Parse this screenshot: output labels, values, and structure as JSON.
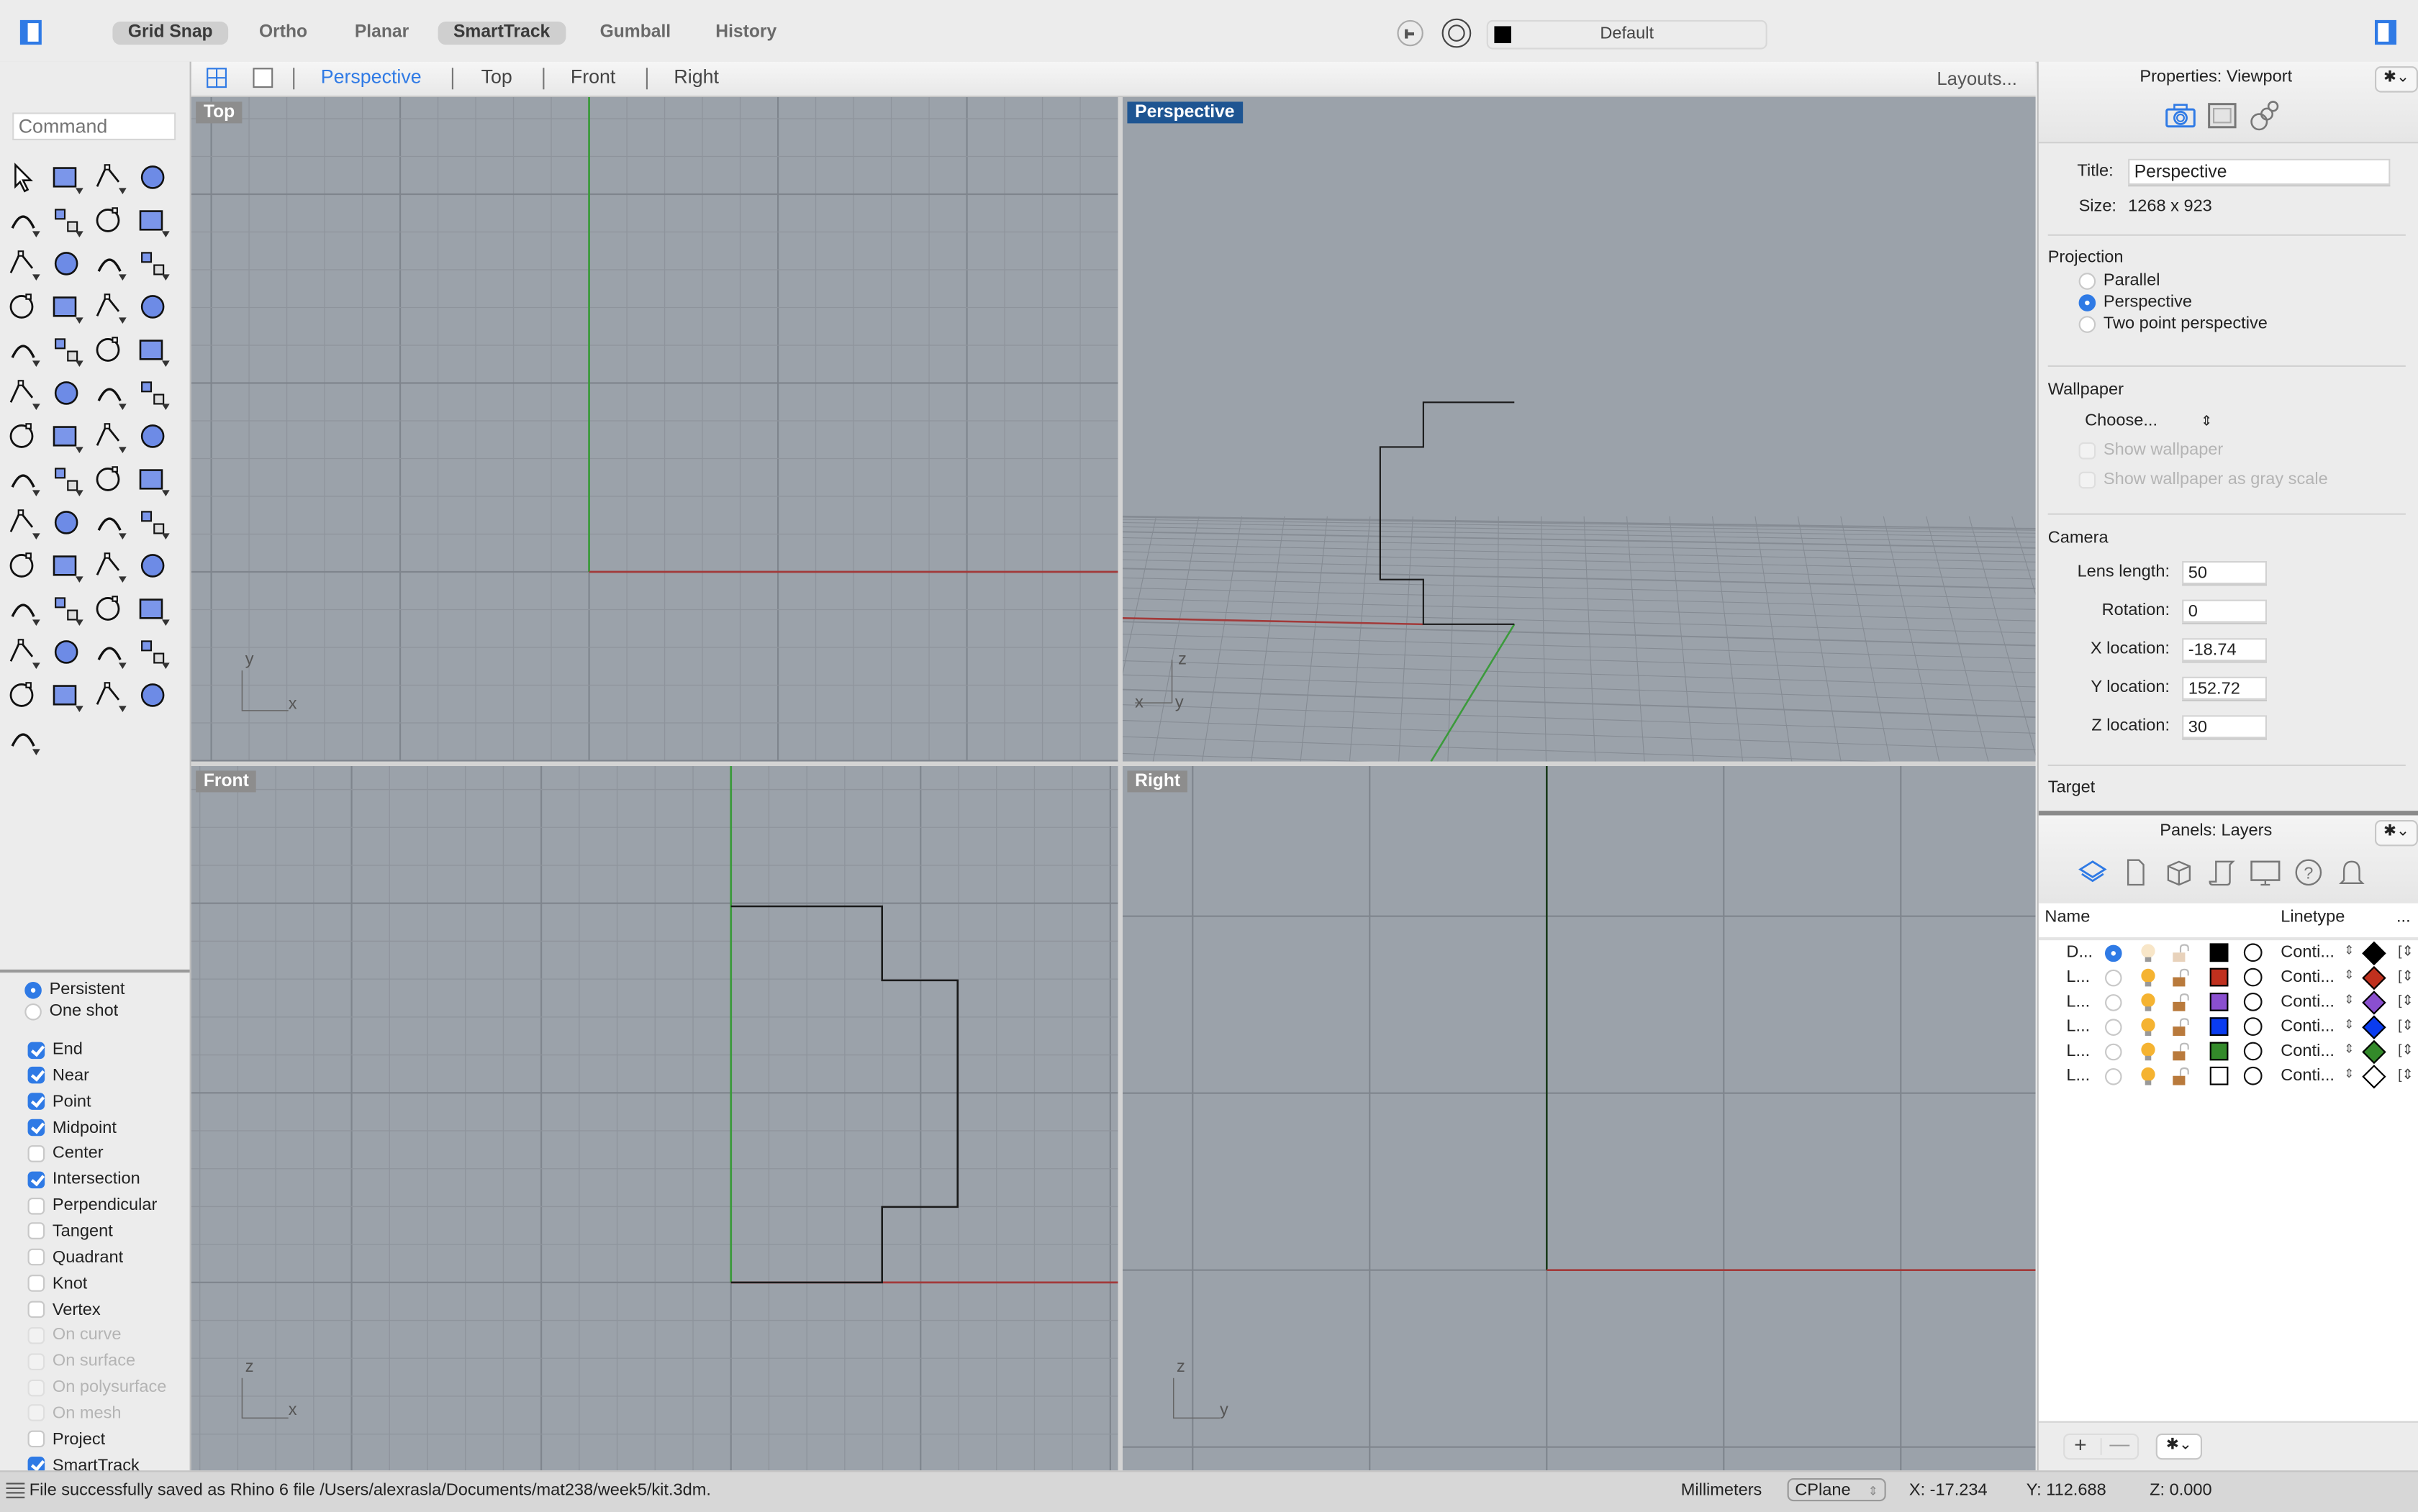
{
  "toolbar": {
    "modes": [
      {
        "label": "Grid Snap",
        "on": true
      },
      {
        "label": "Ortho",
        "on": false
      },
      {
        "label": "Planar",
        "on": false
      },
      {
        "label": "SmartTrack",
        "on": true
      },
      {
        "label": "Gumball",
        "on": false
      },
      {
        "label": "History",
        "on": false
      }
    ],
    "current_layer": "Default",
    "current_layer_color": "#000000"
  },
  "viewport_tabs": {
    "tabs": [
      "Perspective",
      "Top",
      "Front",
      "Right"
    ],
    "active": "Perspective",
    "layouts_label": "Layouts..."
  },
  "command": {
    "placeholder": "Command"
  },
  "osnap": {
    "mode_options": [
      {
        "label": "Persistent",
        "selected": true
      },
      {
        "label": "One shot",
        "selected": false
      }
    ],
    "snaps": [
      {
        "label": "End",
        "checked": true,
        "enabled": true
      },
      {
        "label": "Near",
        "checked": true,
        "enabled": true
      },
      {
        "label": "Point",
        "checked": true,
        "enabled": true
      },
      {
        "label": "Midpoint",
        "checked": true,
        "enabled": true
      },
      {
        "label": "Center",
        "checked": false,
        "enabled": true
      },
      {
        "label": "Intersection",
        "checked": true,
        "enabled": true
      },
      {
        "label": "Perpendicular",
        "checked": false,
        "enabled": true
      },
      {
        "label": "Tangent",
        "checked": false,
        "enabled": true
      },
      {
        "label": "Quadrant",
        "checked": false,
        "enabled": true
      },
      {
        "label": "Knot",
        "checked": false,
        "enabled": true
      },
      {
        "label": "Vertex",
        "checked": false,
        "enabled": true
      },
      {
        "label": "On curve",
        "checked": false,
        "enabled": false
      },
      {
        "label": "On surface",
        "checked": false,
        "enabled": false
      },
      {
        "label": "On polysurface",
        "checked": false,
        "enabled": false
      },
      {
        "label": "On mesh",
        "checked": false,
        "enabled": false
      },
      {
        "label": "Project",
        "checked": false,
        "enabled": true
      },
      {
        "label": "SmartTrack",
        "checked": true,
        "enabled": true
      }
    ]
  },
  "tools": [
    "select-arrow-icon",
    "point-icon",
    "polyline-icon",
    "curve-icon",
    "circle-icon",
    "ellipse-icon",
    "arc-icon",
    "rectangle-icon",
    "polygon-icon",
    "fillet-curve-icon",
    "surface-from-points-icon",
    "extrude-surface-icon",
    "box-solid-icon",
    "sphere-boolean-icon",
    "pipe-surface-icon",
    "mesh-surface-icon",
    "join-puzzle-icon",
    "explode-icon",
    "trim-icon",
    "split-icon",
    "group-icon",
    "ungroup-icon",
    "rebuild-curve-icon",
    "offset-curve-icon",
    "text-icon",
    "move-icon",
    "copy-icon",
    "rotate-icon",
    "solid-tools-icon",
    "extrude-arrows-icon",
    "array-icon",
    "mirror-icon",
    "fillet-edge-icon",
    "check-icon",
    "primitives-icon",
    "pyramid-hand-icon",
    "zoom-in-out-icon",
    "zoom-window-icon",
    "zoom-extents-icon",
    "zoom-selected-icon",
    "rotate-view-icon",
    "walkabout-car-icon",
    "cplane-grid-icon",
    "select-objects-icon",
    "lightbulb-icon",
    "lock-icon",
    "layer-cake-icon",
    "color-wheel-icon",
    "shaded-sphere-icon",
    "grid-sphere-icon",
    "render-sphere-icon",
    "cone-light-icon",
    "dimension-icon"
  ],
  "viewports": {
    "top": {
      "label": "Top",
      "axis_labels": [
        "y",
        "x"
      ]
    },
    "perspective": {
      "label": "Perspective",
      "axis_labels": [
        "z",
        "x",
        "y"
      ]
    },
    "front": {
      "label": "Front",
      "axis_labels": [
        "z",
        "x"
      ]
    },
    "right": {
      "label": "Right",
      "axis_labels": [
        "z",
        "y"
      ]
    }
  },
  "properties": {
    "title": "Properties: Viewport",
    "fields": {
      "title_label": "Title:",
      "title_value": "Perspective",
      "size_label": "Size:",
      "size_value": "1268 x 923"
    },
    "projection": {
      "heading": "Projection",
      "options": [
        {
          "label": "Parallel",
          "selected": false
        },
        {
          "label": "Perspective",
          "selected": true
        },
        {
          "label": "Two point perspective",
          "selected": false
        }
      ]
    },
    "wallpaper": {
      "heading": "Wallpaper",
      "choose_label": "Choose...",
      "show_wallpaper": "Show wallpaper",
      "show_gray": "Show wallpaper as gray scale"
    },
    "camera": {
      "heading": "Camera",
      "rows": [
        {
          "label": "Lens length:",
          "value": "50"
        },
        {
          "label": "Rotation:",
          "value": "0"
        },
        {
          "label": "X location:",
          "value": "-18.74"
        },
        {
          "label": "Y location:",
          "value": "152.72"
        },
        {
          "label": "Z location:",
          "value": "30"
        }
      ]
    },
    "target_heading": "Target"
  },
  "layers": {
    "title": "Panels: Layers",
    "columns": {
      "name": "Name",
      "linetype": "Linetype",
      "more": "..."
    },
    "rows": [
      {
        "name": "D...",
        "current": true,
        "on": false,
        "locked": false,
        "color": "#000000",
        "linetype": "Conti...",
        "print_color": "#000000"
      },
      {
        "name": "L...",
        "current": false,
        "on": true,
        "locked": false,
        "color": "#c0301e",
        "linetype": "Conti...",
        "print_color": "#c0301e"
      },
      {
        "name": "L...",
        "current": false,
        "on": true,
        "locked": false,
        "color": "#8a4fcf",
        "linetype": "Conti...",
        "print_color": "#8a4fcf"
      },
      {
        "name": "L...",
        "current": false,
        "on": true,
        "locked": false,
        "color": "#0a3cf0",
        "linetype": "Conti...",
        "print_color": "#0a3cf0"
      },
      {
        "name": "L...",
        "current": false,
        "on": true,
        "locked": false,
        "color": "#338a2a",
        "linetype": "Conti...",
        "print_color": "#338a2a"
      },
      {
        "name": "L...",
        "current": false,
        "on": true,
        "locked": false,
        "color": "#ffffff",
        "linetype": "Conti...",
        "print_color": "#ffffff"
      }
    ]
  },
  "status": {
    "message": "File successfully saved as Rhino 6 file /Users/alexrasla/Documents/mat238/week5/kit.3dm.",
    "units": "Millimeters",
    "cplane": "CPlane",
    "x": "X: -17.234",
    "y": "Y: 112.688",
    "z": "Z: 0.000"
  },
  "colors": {
    "accent": "#2f7ae5",
    "viewport_bg": "#9ba2aa",
    "active_viewport_label": "#1e5592",
    "x_axis": "#a23a3a",
    "y_axis": "#3c9a3c"
  }
}
